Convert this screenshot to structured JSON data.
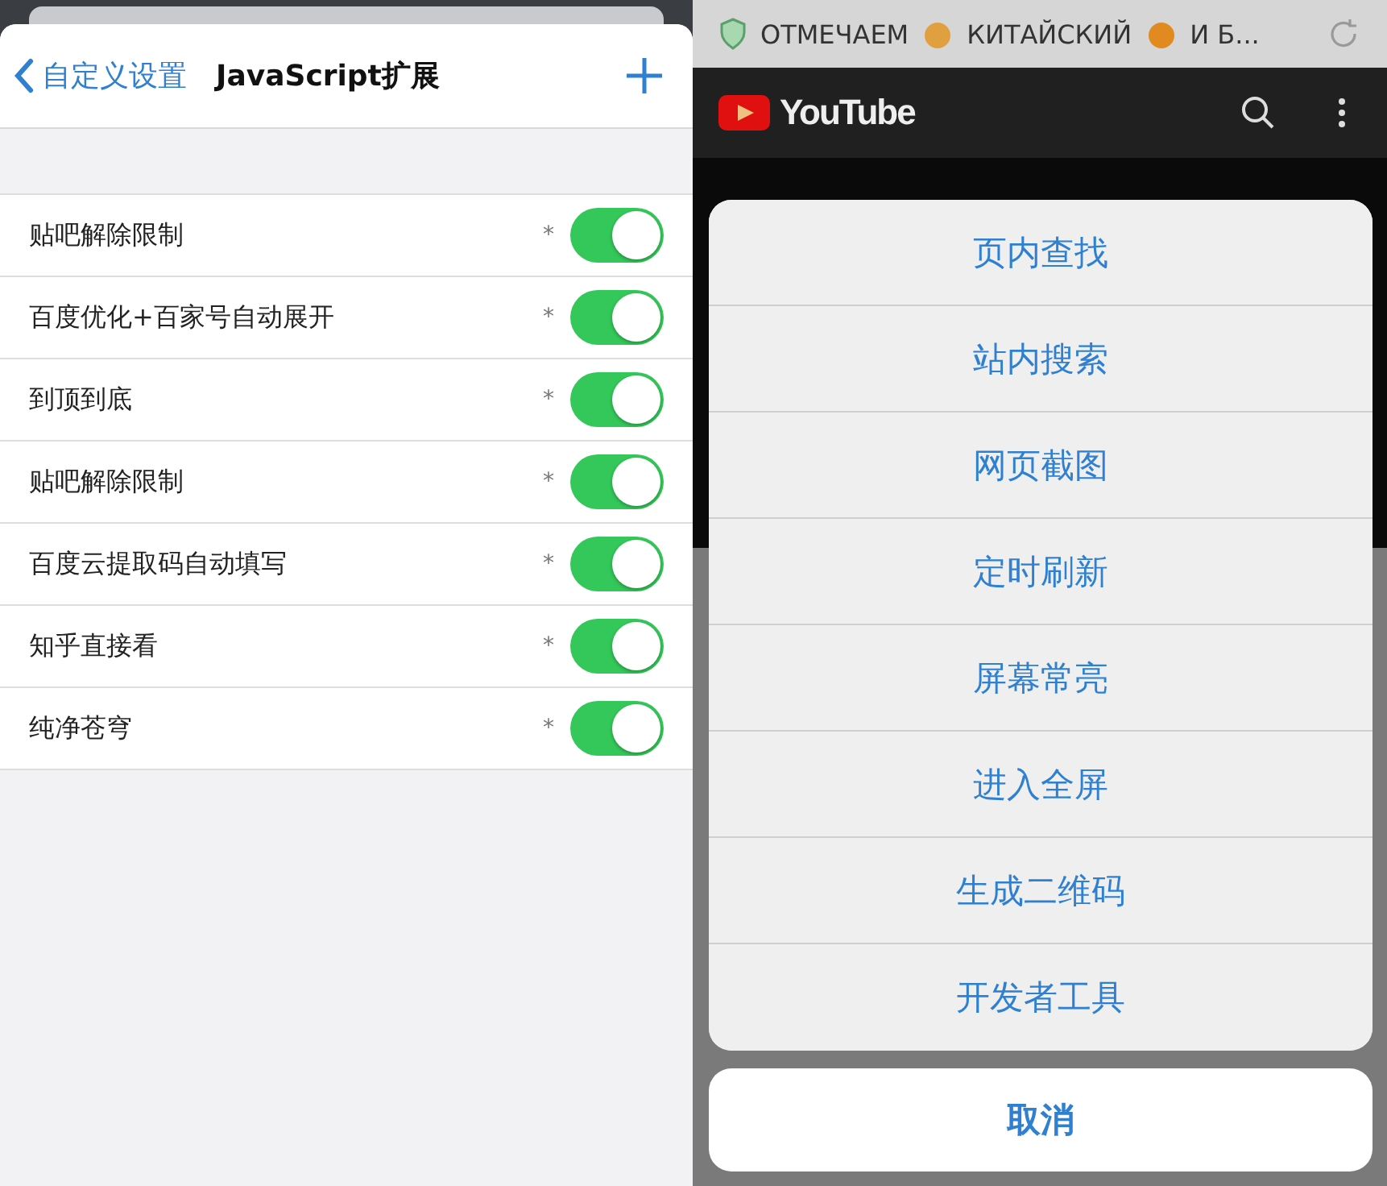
{
  "settings": {
    "back_label": "自定义设置",
    "title": "JavaScript扩展",
    "scripts": [
      {
        "name": "贴吧解除限制",
        "mark": "*",
        "on": true
      },
      {
        "name": "百度优化+百家号自动展开",
        "mark": "*",
        "on": true
      },
      {
        "name": "到顶到底",
        "mark": "*",
        "on": true
      },
      {
        "name": "贴吧解除限制",
        "mark": "*",
        "on": true
      },
      {
        "name": "百度云提取码自动填写",
        "mark": "*",
        "on": true
      },
      {
        "name": "知乎直接看",
        "mark": "*",
        "on": true
      },
      {
        "name": "纯净苍穹",
        "mark": "*",
        "on": true
      }
    ]
  },
  "browser": {
    "title_parts": [
      "ОТМЕЧАЕМ",
      "КИТАЙСКИЙ",
      "И Б..."
    ],
    "site_logo": "YouTube",
    "menu": [
      "页内查找",
      "站内搜索",
      "网页截图",
      "定时刷新",
      "屏幕常亮",
      "进入全屏",
      "生成二维码",
      "开发者工具"
    ],
    "cancel": "取消"
  }
}
